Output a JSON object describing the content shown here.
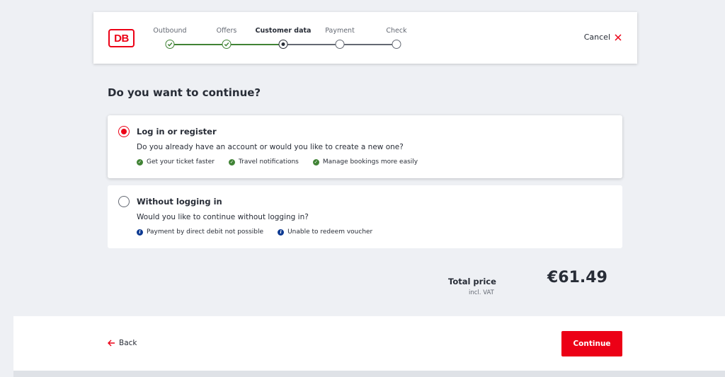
{
  "brand": {
    "logo_text": "DB",
    "accent": "#ec0016"
  },
  "progress": {
    "steps": [
      {
        "label": "Outbound",
        "state": "done"
      },
      {
        "label": "Offers",
        "state": "done"
      },
      {
        "label": "Customer data",
        "state": "current"
      },
      {
        "label": "Payment",
        "state": "upcoming"
      },
      {
        "label": "Check",
        "state": "upcoming"
      }
    ]
  },
  "header": {
    "cancel_label": "Cancel",
    "cancel_icon": "close-icon"
  },
  "main": {
    "heading": "Do you want to continue?",
    "options": [
      {
        "title": "Log in or register",
        "description": "Do you already have an account or would you like to create a new one?",
        "selected": true,
        "features": [
          {
            "icon": "check-circle-icon",
            "text": "Get your ticket faster"
          },
          {
            "icon": "check-circle-icon",
            "text": "Travel notifications"
          },
          {
            "icon": "check-circle-icon",
            "text": "Manage bookings more easily"
          }
        ]
      },
      {
        "title": "Without logging in",
        "description": "Would you like to continue without logging in?",
        "selected": false,
        "features": [
          {
            "icon": "info-circle-icon",
            "text": "Payment by direct debit not possible"
          },
          {
            "icon": "info-circle-icon",
            "text": "Unable to redeem voucher"
          }
        ]
      }
    ]
  },
  "price": {
    "label": "Total price",
    "vat_note": "incl. VAT",
    "amount": "€61.49"
  },
  "footer": {
    "back_label": "Back",
    "continue_label": "Continue"
  },
  "colors": {
    "success": "#408335",
    "info": "#0c3992",
    "text": "#282d37",
    "background": "#eef0f4"
  }
}
